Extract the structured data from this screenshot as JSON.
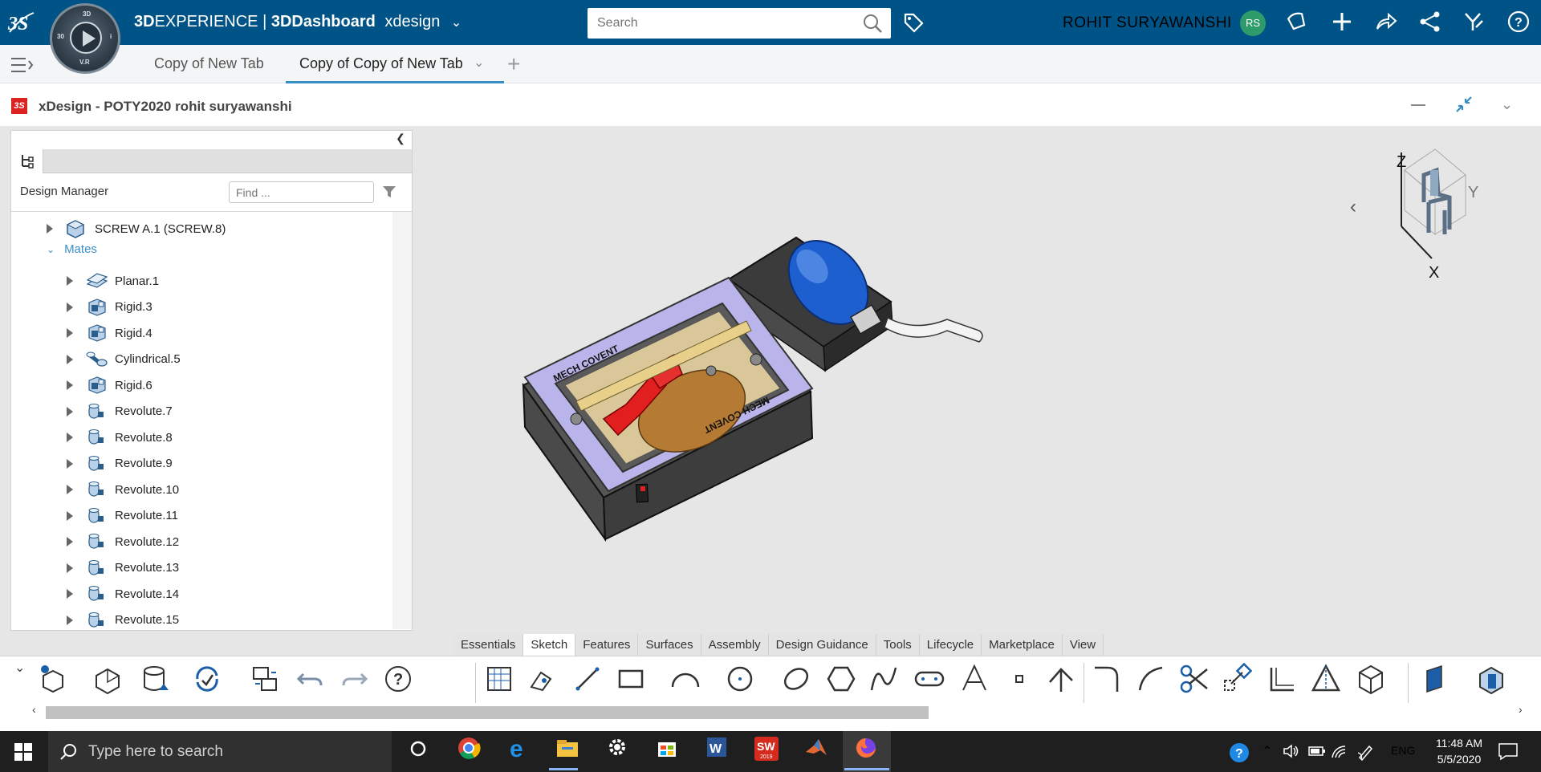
{
  "topbar": {
    "brand_prefix": "3D",
    "brand_experience": "EXPERIENCE",
    "brand_sep": " | ",
    "brand_app": "3DDashboard",
    "brand_space": "xdesign",
    "search_placeholder": "Search",
    "user_name": "ROHIT SURYAWANSHI",
    "user_initials": "RS",
    "compass_labels": {
      "top": "3D",
      "left": "30",
      "right": "i",
      "bottom": "V.R"
    }
  },
  "dashboard_tabs": [
    {
      "label": "Copy of New Tab"
    },
    {
      "label": "Copy of Copy of New Tab"
    }
  ],
  "app": {
    "title": "xDesign - POTY2020 rohit suryawanshi",
    "icon": "3S"
  },
  "design_manager": {
    "label": "Design Manager",
    "find_placeholder": "Find ...",
    "screw_item": "SCREW A.1 (SCREW.8)",
    "mates_label": "Mates",
    "items": [
      {
        "label": "Planar.1",
        "icon": "planar-mate-icon"
      },
      {
        "label": "Rigid.3",
        "icon": "rigid-mate-icon"
      },
      {
        "label": "Rigid.4",
        "icon": "rigid-mate-icon"
      },
      {
        "label": "Cylindrical.5",
        "icon": "cylindrical-mate-icon"
      },
      {
        "label": "Rigid.6",
        "icon": "rigid-mate-icon"
      },
      {
        "label": "Revolute.7",
        "icon": "revolute-mate-icon"
      },
      {
        "label": "Revolute.8",
        "icon": "revolute-mate-icon"
      },
      {
        "label": "Revolute.9",
        "icon": "revolute-mate-icon"
      },
      {
        "label": "Revolute.10",
        "icon": "revolute-mate-icon"
      },
      {
        "label": "Revolute.11",
        "icon": "revolute-mate-icon"
      },
      {
        "label": "Revolute.12",
        "icon": "revolute-mate-icon"
      },
      {
        "label": "Revolute.13",
        "icon": "revolute-mate-icon"
      },
      {
        "label": "Revolute.14",
        "icon": "revolute-mate-icon"
      },
      {
        "label": "Revolute.15",
        "icon": "revolute-mate-icon"
      }
    ]
  },
  "model": {
    "label_top": "MECH COVENT",
    "label_side": "MECH COVENT"
  },
  "view_cube": {
    "z": "Z",
    "y": "Y",
    "x": "X"
  },
  "command_tabs": [
    "Essentials",
    "Sketch",
    "Features",
    "Surfaces",
    "Assembly",
    "Design Guidance",
    "Tools",
    "Lifecycle",
    "Marketplace",
    "View"
  ],
  "active_command_tab": "Sketch",
  "taskbar": {
    "search_placeholder": "Type here to search",
    "lang": "ENG",
    "time": "11:48 AM",
    "date": "5/5/2020",
    "solidworks_year": "2019",
    "solidworks_label": "SW"
  },
  "colors": {
    "topbar": "#005386",
    "accent": "#368ec4",
    "mates": "#3a8fc7"
  }
}
